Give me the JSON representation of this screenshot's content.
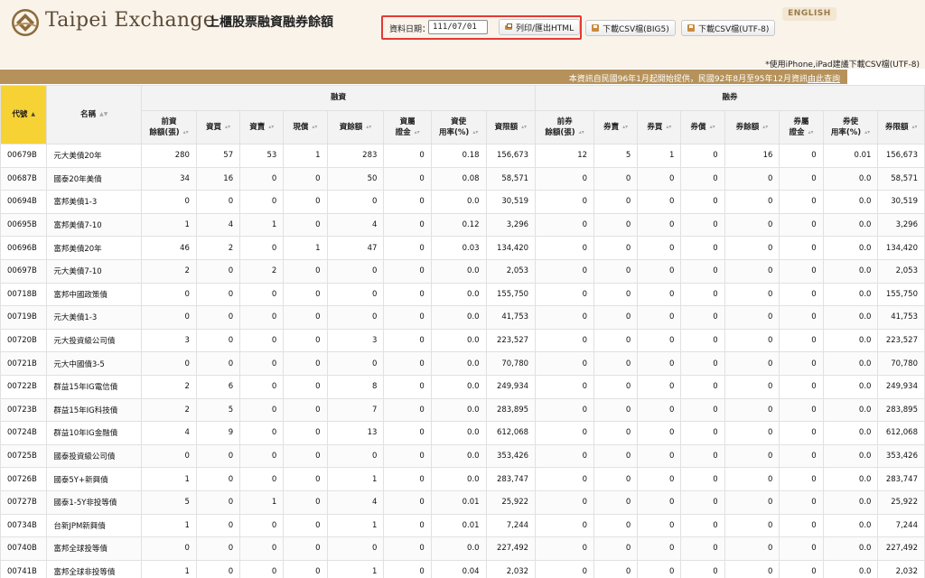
{
  "header": {
    "brand": "Taipei Exchange",
    "title": "上櫃股票融資融券餘額",
    "english_label": "ENGLISH"
  },
  "query": {
    "date_label": "資料日期：",
    "date_value": "111/07/01",
    "print_label": "列印/匯出HTML",
    "csv_big5_label": "下載CSV檔(BIG5)",
    "csv_utf8_label": "下載CSV檔(UTF-8)"
  },
  "note": "*使用iPhone,iPad建議下載CSV檔(UTF-8)",
  "band": {
    "text": "本資訊自民國96年1月起開始提供，民國92年8月至95年12月資訊",
    "link": "由此查詢"
  },
  "table": {
    "code_header": "代號",
    "name_header": "名稱",
    "margin_group": "融資",
    "short_group": "融券",
    "sub_headers": [
      "前資\n餘額(張)",
      "資買",
      "資賣",
      "現償",
      "資餘額",
      "資屬\n證金",
      "資使\n用率(%)",
      "資限額",
      "前券\n餘額(張)",
      "券賣",
      "券買",
      "券償",
      "券餘額",
      "券屬\n證金",
      "券使\n用率(%)",
      "券限額"
    ],
    "rows": [
      [
        "00679B",
        "元大美債20年",
        "280",
        "57",
        "53",
        "1",
        "283",
        "0",
        "0.18",
        "156,673",
        "12",
        "5",
        "1",
        "0",
        "16",
        "0",
        "0.01",
        "156,673"
      ],
      [
        "00687B",
        "國泰20年美債",
        "34",
        "16",
        "0",
        "0",
        "50",
        "0",
        "0.08",
        "58,571",
        "0",
        "0",
        "0",
        "0",
        "0",
        "0",
        "0.0",
        "58,571"
      ],
      [
        "00694B",
        "富邦美債1-3",
        "0",
        "0",
        "0",
        "0",
        "0",
        "0",
        "0.0",
        "30,519",
        "0",
        "0",
        "0",
        "0",
        "0",
        "0",
        "0.0",
        "30,519"
      ],
      [
        "00695B",
        "富邦美債7-10",
        "1",
        "4",
        "1",
        "0",
        "4",
        "0",
        "0.12",
        "3,296",
        "0",
        "0",
        "0",
        "0",
        "0",
        "0",
        "0.0",
        "3,296"
      ],
      [
        "00696B",
        "富邦美債20年",
        "46",
        "2",
        "0",
        "1",
        "47",
        "0",
        "0.03",
        "134,420",
        "0",
        "0",
        "0",
        "0",
        "0",
        "0",
        "0.0",
        "134,420"
      ],
      [
        "00697B",
        "元大美債7-10",
        "2",
        "0",
        "2",
        "0",
        "0",
        "0",
        "0.0",
        "2,053",
        "0",
        "0",
        "0",
        "0",
        "0",
        "0",
        "0.0",
        "2,053"
      ],
      [
        "00718B",
        "富邦中國政策債",
        "0",
        "0",
        "0",
        "0",
        "0",
        "0",
        "0.0",
        "155,750",
        "0",
        "0",
        "0",
        "0",
        "0",
        "0",
        "0.0",
        "155,750"
      ],
      [
        "00719B",
        "元大美債1-3",
        "0",
        "0",
        "0",
        "0",
        "0",
        "0",
        "0.0",
        "41,753",
        "0",
        "0",
        "0",
        "0",
        "0",
        "0",
        "0.0",
        "41,753"
      ],
      [
        "00720B",
        "元大投資級公司債",
        "3",
        "0",
        "0",
        "0",
        "3",
        "0",
        "0.0",
        "223,527",
        "0",
        "0",
        "0",
        "0",
        "0",
        "0",
        "0.0",
        "223,527"
      ],
      [
        "00721B",
        "元大中國債3-5",
        "0",
        "0",
        "0",
        "0",
        "0",
        "0",
        "0.0",
        "70,780",
        "0",
        "0",
        "0",
        "0",
        "0",
        "0",
        "0.0",
        "70,780"
      ],
      [
        "00722B",
        "群益15年IG電信債",
        "2",
        "6",
        "0",
        "0",
        "8",
        "0",
        "0.0",
        "249,934",
        "0",
        "0",
        "0",
        "0",
        "0",
        "0",
        "0.0",
        "249,934"
      ],
      [
        "00723B",
        "群益15年IG科技債",
        "2",
        "5",
        "0",
        "0",
        "7",
        "0",
        "0.0",
        "283,895",
        "0",
        "0",
        "0",
        "0",
        "0",
        "0",
        "0.0",
        "283,895"
      ],
      [
        "00724B",
        "群益10年IG金融債",
        "4",
        "9",
        "0",
        "0",
        "13",
        "0",
        "0.0",
        "612,068",
        "0",
        "0",
        "0",
        "0",
        "0",
        "0",
        "0.0",
        "612,068"
      ],
      [
        "00725B",
        "國泰投資級公司債",
        "0",
        "0",
        "0",
        "0",
        "0",
        "0",
        "0.0",
        "353,426",
        "0",
        "0",
        "0",
        "0",
        "0",
        "0",
        "0.0",
        "353,426"
      ],
      [
        "00726B",
        "國泰5Y+新興債",
        "1",
        "0",
        "0",
        "0",
        "1",
        "0",
        "0.0",
        "283,747",
        "0",
        "0",
        "0",
        "0",
        "0",
        "0",
        "0.0",
        "283,747"
      ],
      [
        "00727B",
        "國泰1-5Y非投等債",
        "5",
        "0",
        "1",
        "0",
        "4",
        "0",
        "0.01",
        "25,922",
        "0",
        "0",
        "0",
        "0",
        "0",
        "0",
        "0.0",
        "25,922"
      ],
      [
        "00734B",
        "台新JPM新興債",
        "1",
        "0",
        "0",
        "0",
        "1",
        "0",
        "0.01",
        "7,244",
        "0",
        "0",
        "0",
        "0",
        "0",
        "0",
        "0.0",
        "7,244"
      ],
      [
        "00740B",
        "富邦全球投等債",
        "0",
        "0",
        "0",
        "0",
        "0",
        "0",
        "0.0",
        "227,492",
        "0",
        "0",
        "0",
        "0",
        "0",
        "0",
        "0.0",
        "227,492"
      ],
      [
        "00741B",
        "富邦全球非投等債",
        "1",
        "0",
        "0",
        "0",
        "1",
        "0",
        "0.04",
        "2,032",
        "0",
        "0",
        "0",
        "0",
        "0",
        "0",
        "0.0",
        "2,032"
      ]
    ]
  },
  "colors": {
    "header_bg": "#f9f3ea",
    "band": "#b6925a",
    "sort_active": "#f7d235",
    "highlight_border": "#e53935"
  },
  "icons": {
    "logo": "taipei-exchange-logo",
    "print": "printer-icon",
    "csv": "disk-icon"
  }
}
